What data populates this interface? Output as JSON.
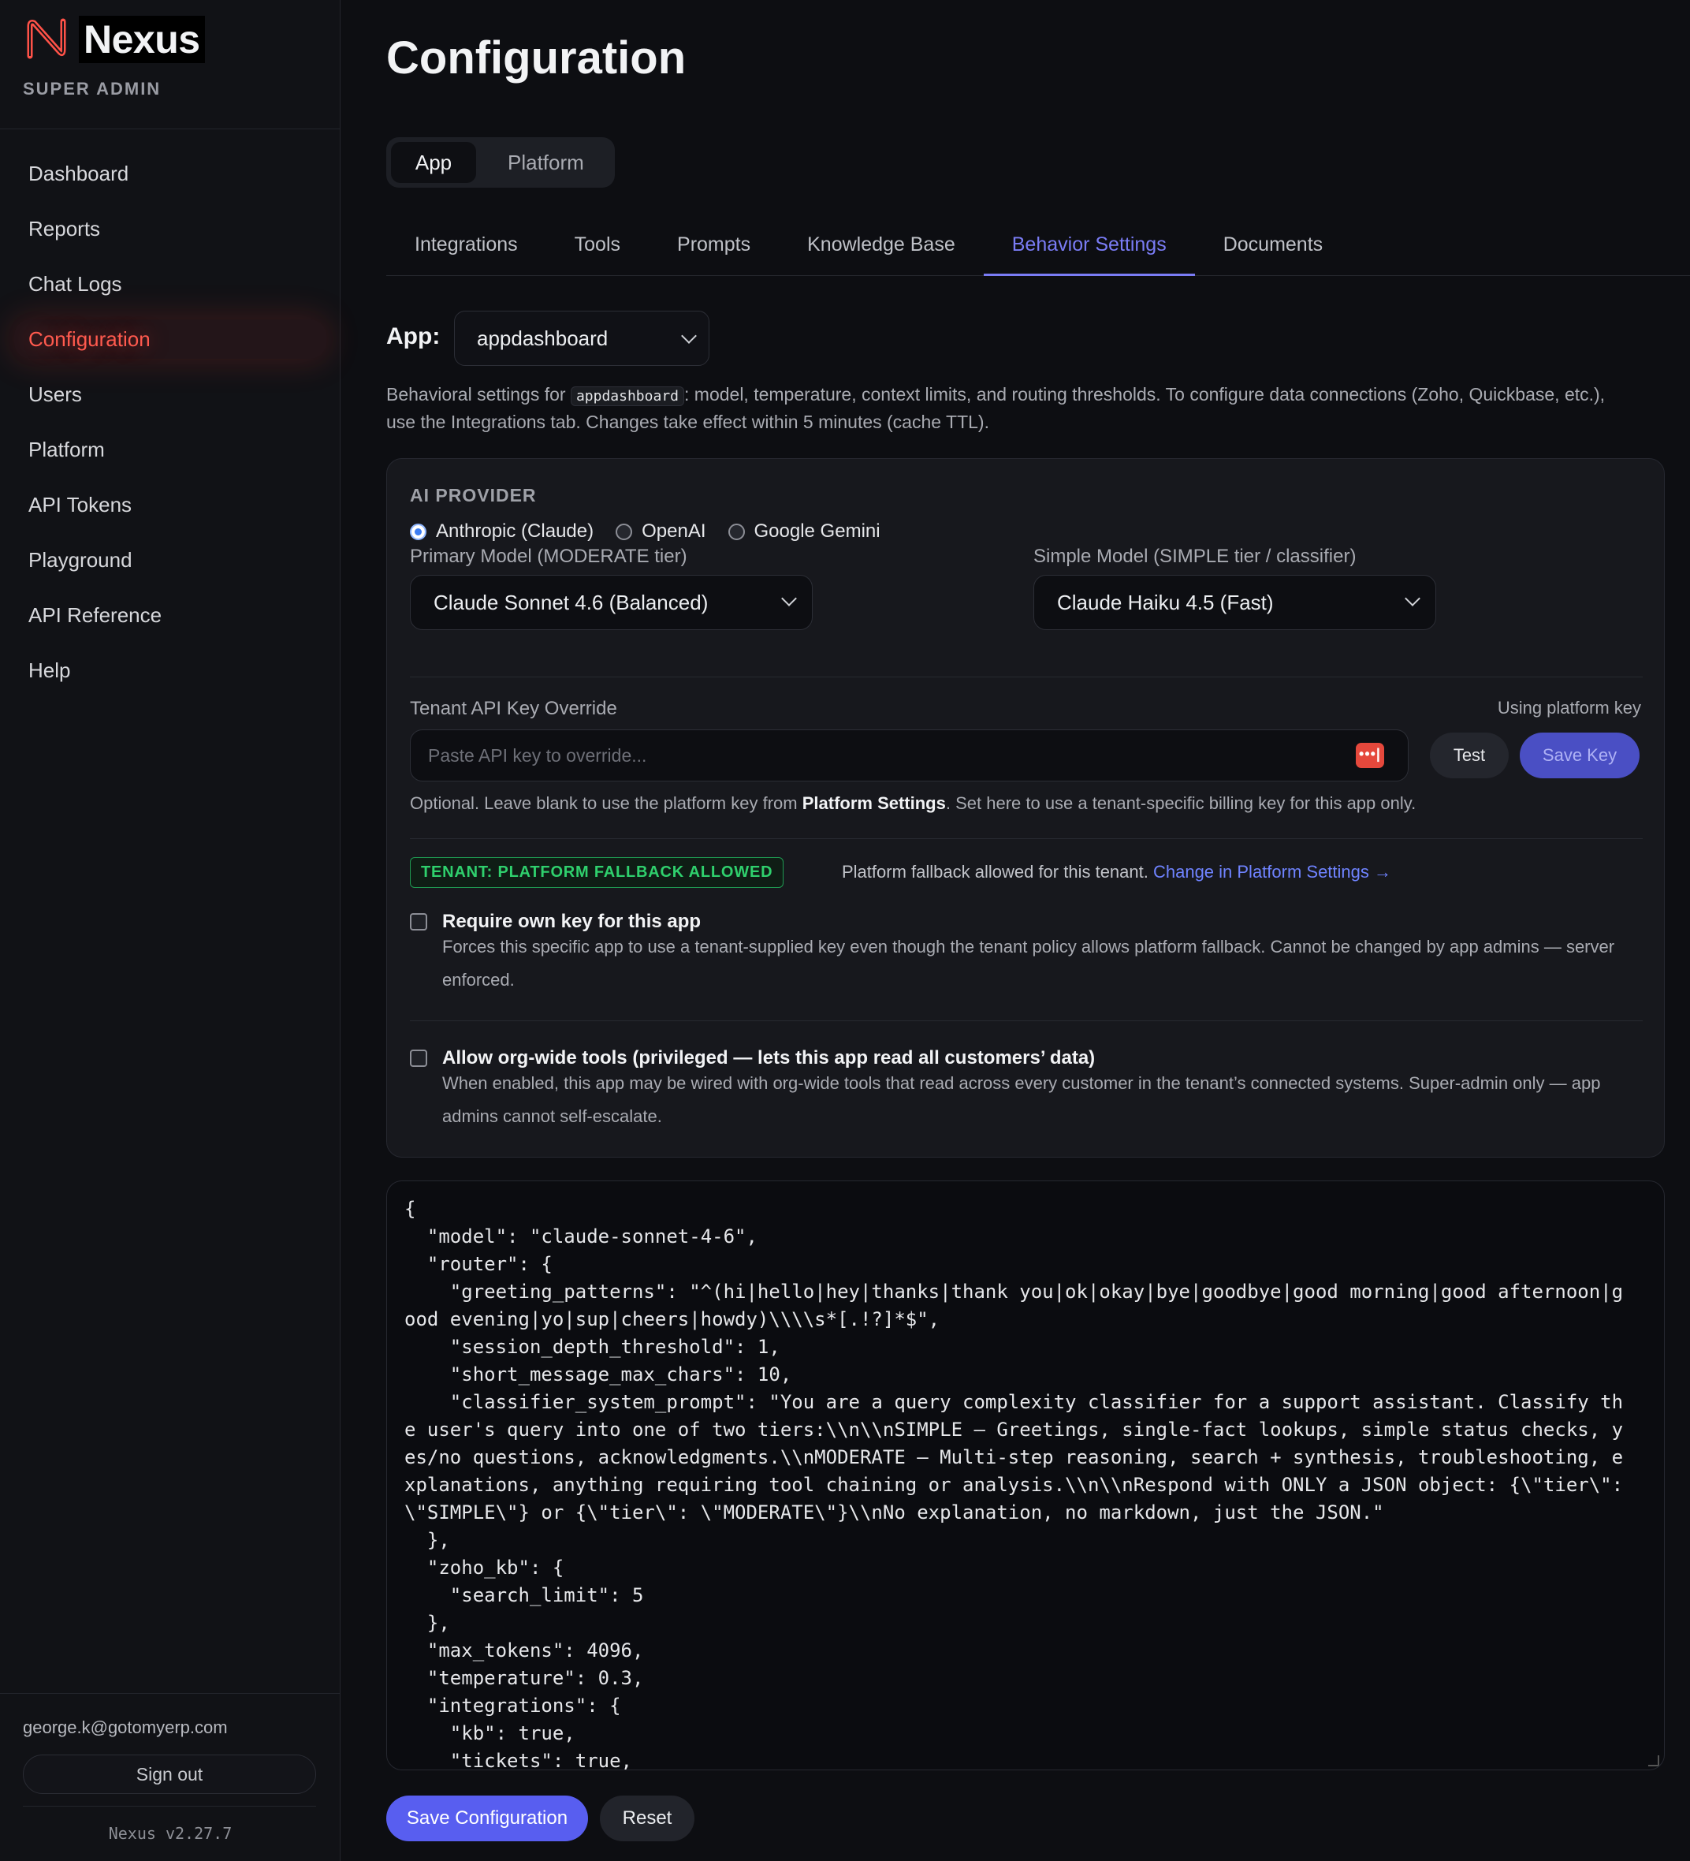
{
  "sidebar": {
    "brand": "Nexus",
    "role": "SUPER ADMIN",
    "items": [
      {
        "label": "Dashboard"
      },
      {
        "label": "Reports"
      },
      {
        "label": "Chat Logs"
      },
      {
        "label": "Configuration",
        "active": true
      },
      {
        "label": "Users"
      },
      {
        "label": "Platform"
      },
      {
        "label": "API Tokens"
      },
      {
        "label": "Playground"
      },
      {
        "label": "API Reference"
      },
      {
        "label": "Help"
      }
    ],
    "user_email": "george.k@gotomyerp.com",
    "signout_label": "Sign out",
    "version": "Nexus v2.27.7"
  },
  "page": {
    "title": "Configuration",
    "scope_tabs": [
      "App",
      "Platform"
    ],
    "tabs": [
      "Integrations",
      "Tools",
      "Prompts",
      "Knowledge Base",
      "Behavior Settings",
      "Documents"
    ],
    "active_tab": "Behavior Settings",
    "app_label": "App:",
    "app_value": "appdashboard",
    "desc_pre": "Behavioral settings for ",
    "desc_code": "appdashboard",
    "desc_post": ": model, temperature, context limits, and routing thresholds. To configure data connections (Zoho, Quickbase, etc.), use the Integrations tab. Changes take effect within 5 minutes (cache TTL)."
  },
  "provider": {
    "section_title": "AI PROVIDER",
    "options": [
      "Anthropic (Claude)",
      "OpenAI",
      "Google Gemini"
    ],
    "selected": "Anthropic (Claude)",
    "primary_label": "Primary Model (MODERATE tier)",
    "primary_value": "Claude Sonnet 4.6 (Balanced)",
    "simple_label": "Simple Model (SIMPLE tier / classifier)",
    "simple_value": "Claude Haiku 4.5 (Fast)"
  },
  "api_key": {
    "label": "Tenant API Key Override",
    "status": "Using platform key",
    "placeholder": "Paste API key to override...",
    "pw_icon": "•••|",
    "test_label": "Test",
    "save_label": "Save Key",
    "help_pre": "Optional. Leave blank to use the platform key from ",
    "help_bold": "Platform Settings",
    "help_post": ". Set here to use a tenant-specific billing key for this app only."
  },
  "policy": {
    "badge": "TENANT: PLATFORM FALLBACK ALLOWED",
    "text": "Platform fallback allowed for this tenant. ",
    "link": "Change in Platform Settings →",
    "require_key_title": "Require own key for this app",
    "require_key_desc": "Forces this specific app to use a tenant-supplied key even though the tenant policy allows platform fallback. Cannot be changed by app admins — server enforced.",
    "orgwide_title": "Allow org-wide tools (privileged — lets this app read all customers’ data)",
    "orgwide_desc": "When enabled, this app may be wired with org-wide tools that read across every customer in the tenant’s connected systems. Super-admin only — app admins cannot self-escalate."
  },
  "json_editor": {
    "content": "{\n  \"model\": \"claude-sonnet-4-6\",\n  \"router\": {\n    \"greeting_patterns\": \"^(hi|hello|hey|thanks|thank you|ok|okay|bye|goodbye|good morning|good afternoon|good evening|yo|sup|cheers|howdy)\\\\\\\\s*[.!?]*$\",\n    \"session_depth_threshold\": 1,\n    \"short_message_max_chars\": 10,\n    \"classifier_system_prompt\": \"You are a query complexity classifier for a support assistant. Classify the user's query into one of two tiers:\\\\n\\\\nSIMPLE — Greetings, single-fact lookups, simple status checks, yes/no questions, acknowledgments.\\\\nMODERATE — Multi-step reasoning, search + synthesis, troubleshooting, explanations, anything requiring tool chaining or analysis.\\\\n\\\\nRespond with ONLY a JSON object: {\\\"tier\\\": \\\"SIMPLE\\\"} or {\\\"tier\\\": \\\"MODERATE\\\"}\\\\nNo explanation, no markdown, just the JSON.\"\n  },\n  \"zoho_kb\": {\n    \"search_limit\": 5\n  },\n  \"max_tokens\": 4096,\n  \"temperature\": 0.3,\n  \"integrations\": {\n    \"kb\": true,\n    \"tickets\": true,"
  },
  "actions": {
    "save_label": "Save Configuration",
    "reset_label": "Reset"
  },
  "colors": {
    "accent": "#585ef0",
    "active_nav": "#ff5a4e",
    "tab_active": "#7a7cf5",
    "badge_green": "#2fd06d"
  }
}
